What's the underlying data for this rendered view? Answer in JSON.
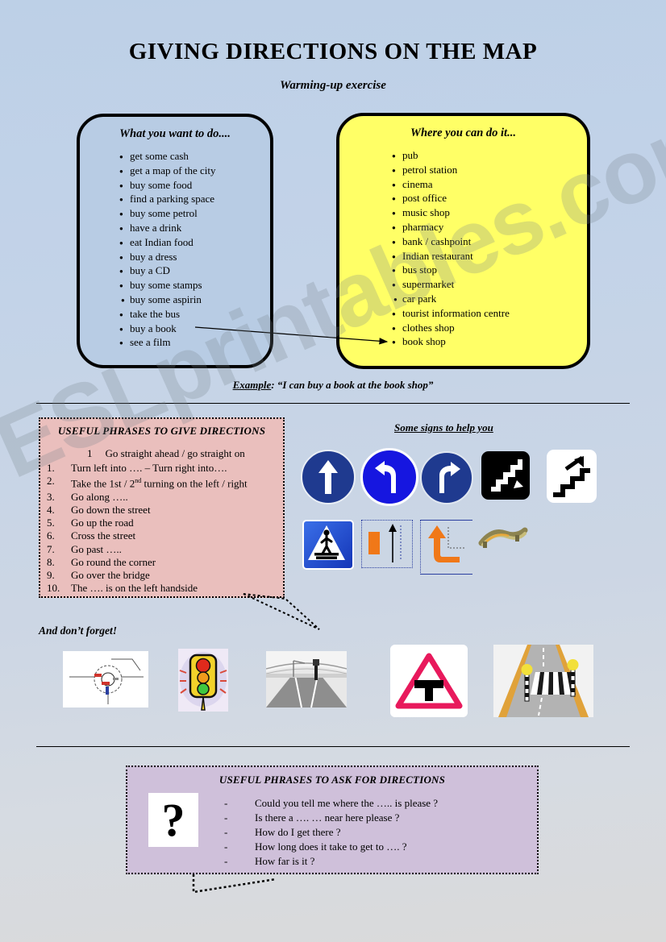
{
  "page": {
    "title": "GIVING DIRECTIONS ON THE MAP",
    "subtitle": "Warming-up exercise",
    "watermark": "ESLprintables.com",
    "background_top": "#bdd0e7",
    "background_bottom": "#dadada"
  },
  "want_box": {
    "heading": "What you want to do....",
    "color": "#b8cce4",
    "items": [
      "get some cash",
      "get a map of the city",
      "buy some food",
      "find a parking space",
      "buy some petrol",
      "have a drink",
      "eat Indian food",
      "buy a dress",
      "buy a CD",
      "buy some stamps",
      "buy some aspirin",
      "take the bus",
      "buy a book",
      "see a film"
    ]
  },
  "where_box": {
    "heading": "Where you can do it...",
    "color": "#ffff66",
    "items": [
      "pub",
      "petrol station",
      "cinema",
      "post office",
      "music shop",
      "pharmacy",
      "bank / cashpoint",
      "Indian restaurant",
      "bus stop",
      "supermarket",
      "car park",
      "tourist information centre",
      "clothes shop",
      "book shop"
    ]
  },
  "example": {
    "label": "Example",
    "text": ": “I can buy a book at the book shop”"
  },
  "give_directions": {
    "title": "USEFUL PHRASES TO GIVE DIRECTIONS",
    "color": "#eabfbd",
    "first_number": "1",
    "first_item": "Go straight ahead / go straight on",
    "items": [
      {
        "n": "1.",
        "text": "Turn left into …. – Turn right into…."
      },
      {
        "n": "2.",
        "text_pre": "Take the 1st  / 2",
        "sup": "nd",
        "text_post": " turning on the left / right"
      },
      {
        "n": "3.",
        "text": "Go along ….."
      },
      {
        "n": "4.",
        "text": "Go down the street"
      },
      {
        "n": "5.",
        "text": "Go up the road"
      },
      {
        "n": "6.",
        "text": "Cross the street"
      },
      {
        "n": "7.",
        "text": "Go past ….."
      },
      {
        "n": "8.",
        "text": "Go round the corner"
      },
      {
        "n": "9.",
        "text": "Go over the bridge"
      },
      {
        "n": "10.",
        "text": "The …. is on the left handside"
      }
    ]
  },
  "signs": {
    "heading": "Some signs to help you",
    "row1": [
      {
        "name": "straight-ahead-sign",
        "color": "#1f3a8f"
      },
      {
        "name": "turn-left-sign",
        "color": "#1616e0"
      },
      {
        "name": "turn-right-sign",
        "color": "#1f3a8f"
      },
      {
        "name": "stairs-down-sign",
        "color": "#000000"
      },
      {
        "name": "stairs-up-sign",
        "color": "#ffffff"
      }
    ],
    "row2": [
      {
        "name": "pedestrian-crossing-sign",
        "color": "#1a4fd6"
      },
      {
        "name": "go-past-diagram",
        "color": "#f07818"
      },
      {
        "name": "turn-corner-diagram",
        "color": "#f07818"
      },
      {
        "name": "bridge-image",
        "color": "#9c9257"
      }
    ]
  },
  "forget": {
    "label": "And don’t forget!",
    "pictures": [
      {
        "name": "roundabout-diagram"
      },
      {
        "name": "traffic-light-image"
      },
      {
        "name": "crossroads-photo"
      },
      {
        "name": "t-junction-sign"
      },
      {
        "name": "zebra-crossing-image"
      }
    ]
  },
  "ask_directions": {
    "title": "USEFUL PHRASES TO ASK FOR DIRECTIONS",
    "color": "#cfc0da",
    "question_mark": "?",
    "items": [
      "Could you tell me where the ….. is please ?",
      "Is there a …. …  near here please ?",
      "How do I get there ?",
      "How long does it take to get to …. ?",
      "How far is it ?"
    ],
    "dash": "-"
  }
}
